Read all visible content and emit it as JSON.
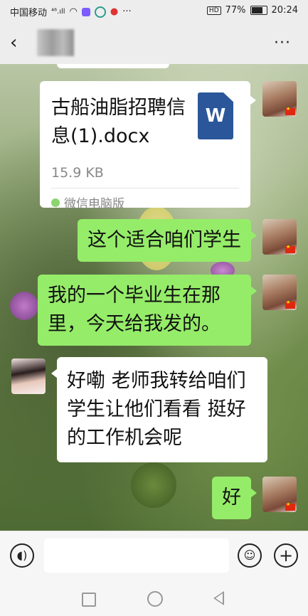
{
  "status_bar": {
    "carrier": "中国移动",
    "signal": "⁴⁶.ıll",
    "icons": [
      "wifi-icon",
      "app-icon",
      "app-icon",
      "app-icon",
      "location-icon"
    ],
    "more": "···",
    "hd": "HD",
    "battery_text": "77%",
    "time": "20:24"
  },
  "header": {
    "back_icon": "back-chevron-icon",
    "contact_name_hidden": true,
    "more_icon": "···"
  },
  "messages": {
    "file": {
      "name": "古船油脂招聘信息(1).docx",
      "size": "15.9 KB",
      "source": "微信电脑版",
      "icon_label": "W"
    },
    "m1": "这个适合咱们学生",
    "m2": "我的一个毕业生在那里，今天给我发的。",
    "m3": "好嘞 老师我转给咱们学生让他们看看 挺好的工作机会呢",
    "m4": "好"
  },
  "input": {
    "voice_icon": "voice-icon",
    "emoji_icon": "emoji-icon",
    "plus_icon": "+",
    "placeholder": ""
  },
  "colors": {
    "sent_bubble": "#95ec69",
    "received_bubble": "#ffffff",
    "bar_background": "#ededed"
  }
}
